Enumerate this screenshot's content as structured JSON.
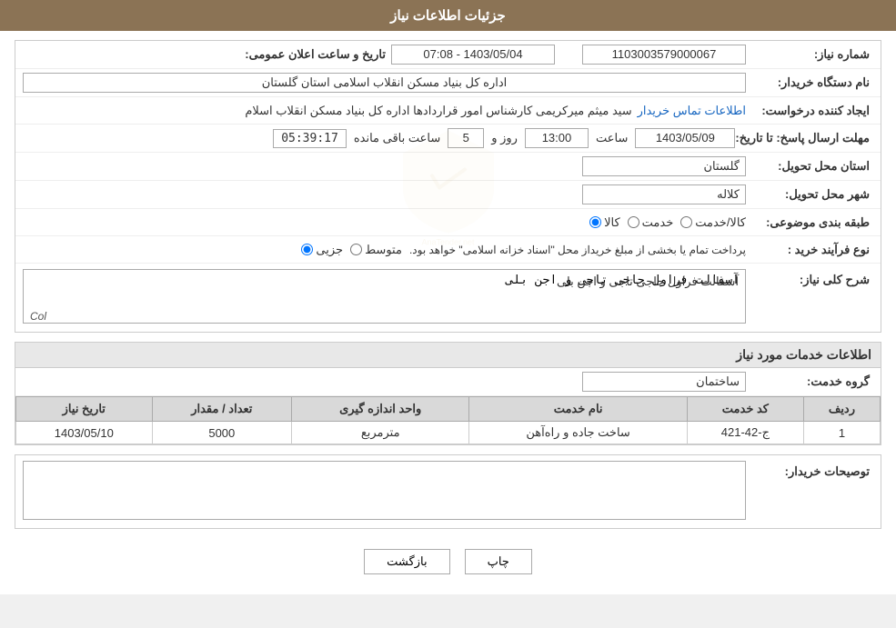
{
  "header": {
    "title": "جزئیات اطلاعات نیاز"
  },
  "form": {
    "need_number_label": "شماره نیاز:",
    "need_number_value": "1103003579000067",
    "announcement_date_label": "تاریخ و ساعت اعلان عمومی:",
    "announcement_date_value": "1403/05/04 - 07:08",
    "buyer_org_label": "نام دستگاه خریدار:",
    "buyer_org_value": "اداره کل بنیاد مسکن انقلاب اسلامی استان گلستان",
    "creator_label": "ایجاد کننده درخواست:",
    "creator_value": "سید میثم میرکریمی کارشناس امور قراردادها اداره کل بنیاد مسکن انقلاب اسلام",
    "creator_link": "اطلاعات تماس خریدار",
    "deadline_label": "مهلت ارسال پاسخ: تا تاریخ:",
    "deadline_date": "1403/05/09",
    "deadline_time_label": "ساعت",
    "deadline_time": "13:00",
    "deadline_days_label": "روز و",
    "deadline_days": "5",
    "deadline_remaining_label": "ساعت باقی مانده",
    "deadline_remaining": "05:39:17",
    "province_label": "استان محل تحویل:",
    "province_value": "گلستان",
    "city_label": "شهر محل تحویل:",
    "city_value": "کلاله",
    "category_label": "طبقه بندی موضوعی:",
    "category_kala": "کالا",
    "category_khadamat": "خدمت",
    "category_kala_khadamat": "کالا/خدمت",
    "purchase_type_label": "نوع فرآیند خرید :",
    "purchase_type_jozee": "جزیی",
    "purchase_type_motavasset": "متوسط",
    "purchase_type_description": "پرداخت تمام یا بخشی از مبلغ خریداز محل \"اسناد خزانه اسلامی\" خواهد بود.",
    "need_description_label": "شرح کلی نیاز:",
    "need_description_value": "آسفالت فراول حاجی تاجی و اجن بلی",
    "services_section_label": "اطلاعات خدمات مورد نیاز",
    "service_group_label": "گروه خدمت:",
    "service_group_value": "ساختمان",
    "table_headers": {
      "row_number": "ردیف",
      "service_code": "کد خدمت",
      "service_name": "نام خدمت",
      "unit": "واحد اندازه گیری",
      "quantity": "تعداد / مقدار",
      "need_date": "تاریخ نیاز"
    },
    "table_rows": [
      {
        "row": "1",
        "service_code": "ج-42-421",
        "service_name": "ساخت جاده و راه‌آهن",
        "unit": "مترمربع",
        "quantity": "5000",
        "need_date": "1403/05/10"
      }
    ],
    "buyer_desc_label": "توصیحات خریدار:",
    "buyer_desc_value": "",
    "col_label": "Col",
    "btn_back": "بازگشت",
    "btn_print": "چاپ"
  }
}
